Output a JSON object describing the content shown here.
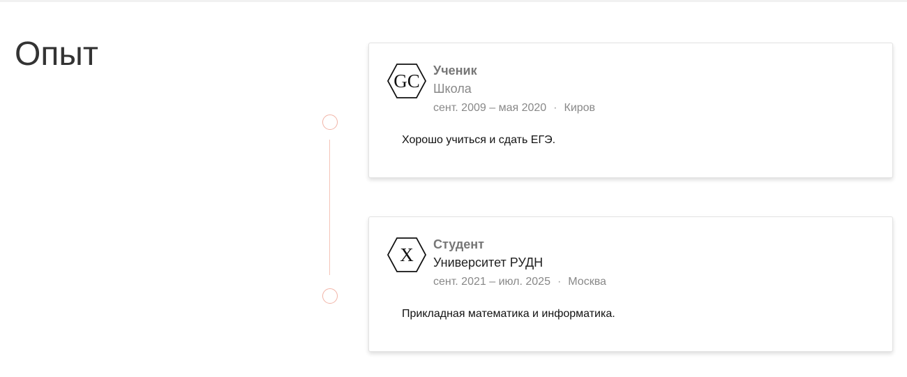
{
  "section": {
    "title": "Опыт"
  },
  "colors": {
    "timeline_accent": "#f1b3a6",
    "muted_text": "#888888"
  },
  "experience": [
    {
      "logo_text": "GC",
      "logo_icon": "hexagon-logo",
      "role": "Ученик",
      "organization": "Школа",
      "dates": "сент. 2009 – мая 2020",
      "separator": "·",
      "location": "Киров",
      "description": "Хорошо учиться и сдать ЕГЭ."
    },
    {
      "logo_text": "X",
      "logo_icon": "hexagon-logo",
      "role": "Студент",
      "organization": "Университет РУДН",
      "dates": "сент. 2021 – июл. 2025",
      "separator": "·",
      "location": "Москва",
      "description": "Прикладная математика и информатика."
    }
  ]
}
